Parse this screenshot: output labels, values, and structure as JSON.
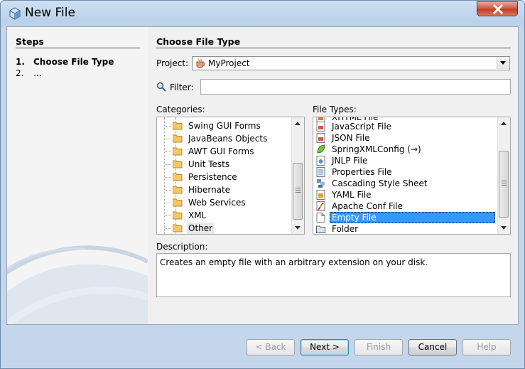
{
  "window": {
    "title": "New File"
  },
  "steps": {
    "heading": "Steps",
    "items": [
      {
        "num": "1.",
        "label": "Choose File Type",
        "current": true
      },
      {
        "num": "2.",
        "label": "...",
        "current": false
      }
    ]
  },
  "main": {
    "heading": "Choose File Type",
    "project_label": "Project:",
    "project_value": "MyProject",
    "filter_label": "Filter:",
    "filter_value": "",
    "categories_label": "Categories:",
    "categories": [
      "Swing GUI Forms",
      "JavaBeans Objects",
      "AWT GUI Forms",
      "Unit Tests",
      "Persistence",
      "Hibernate",
      "Web Services",
      "XML",
      "Other"
    ],
    "selected_category": "Other",
    "file_types_label": "File Types:",
    "file_types": [
      {
        "label": "XHTML File",
        "icon": "xhtml-file-icon"
      },
      {
        "label": "JavaScript File",
        "icon": "javascript-file-icon"
      },
      {
        "label": "JSON File",
        "icon": "json-file-icon"
      },
      {
        "label": "SpringXMLConfig (→)",
        "icon": "spring-leaf-icon"
      },
      {
        "label": "JNLP File",
        "icon": "jnlp-file-icon"
      },
      {
        "label": "Properties File",
        "icon": "properties-file-icon"
      },
      {
        "label": "Cascading Style Sheet",
        "icon": "css-file-icon"
      },
      {
        "label": "YAML File",
        "icon": "yaml-file-icon"
      },
      {
        "label": "Apache Conf File",
        "icon": "apache-feather-icon"
      },
      {
        "label": "Empty File",
        "icon": "empty-file-icon"
      },
      {
        "label": "Folder",
        "icon": "folder-icon"
      }
    ],
    "selected_file_type": "Empty File",
    "description_label": "Description:",
    "description": "Creates an empty file with an arbitrary extension on your disk."
  },
  "buttons": {
    "back": "< Back",
    "next": "Next >",
    "finish": "Finish",
    "cancel": "Cancel",
    "help": "Help"
  },
  "colors": {
    "selection": "#3399ff",
    "title_bar": "#b9d1ea",
    "close_button": "#c94a36"
  }
}
